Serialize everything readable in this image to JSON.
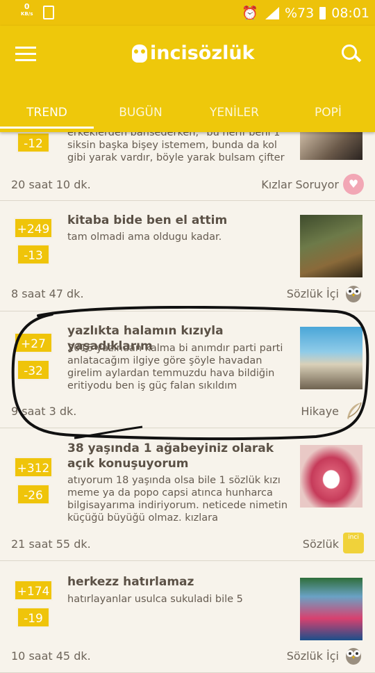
{
  "status_bar": {
    "net_speed": "0",
    "net_unit": "KB/s",
    "battery": "%73",
    "time": "08:01"
  },
  "header": {
    "app_name": "incisözlük"
  },
  "tabs": [
    {
      "label": "TREND"
    },
    {
      "label": "BUGÜN"
    },
    {
      "label": "YENİLER"
    },
    {
      "label": "POPİ"
    }
  ],
  "entries": [
    {
      "up": "",
      "down": "-12",
      "title": "",
      "body": "erkeklerden bahsederken, \"bu herif beni 1 siksin başka bişey istemem, bunda da kol gibi yarak vardır, böyle yarak bulsam çifter",
      "time": "20 saat 10 dk.",
      "source": "Kızlar Soruyor",
      "source_icon": "heart-icon"
    },
    {
      "up": "+249",
      "down": "-13",
      "title": "kitaba bide ben el attim",
      "body": "tam olmadi ama oldugu kadar.",
      "time": "8 saat 47 dk.",
      "source": "Sözlük İçi",
      "source_icon": "owl-icon"
    },
    {
      "up": "+27",
      "down": "-32",
      "title": "yazlıkta halamın kızıyla yaşadıklarım",
      "body": "2016 yazından kalma bi anımdır parti parti anlatacağım ilgiye göre şöyle havadan girelim aylardan temmuzdu hava bildiğin eritiyodu ben iş güç falan sıkıldım",
      "time": "9 saat 3 dk.",
      "source": "Hikaye",
      "source_icon": "feather-icon"
    },
    {
      "up": "+312",
      "down": "-26",
      "title": "38 yaşında 1 ağabeyiniz olarak açık konuşuyorum",
      "body": "atıyorum 18 yaşında olsa bile 1 sözlük kızı meme ya da popo capsi atınca hunharca bilgisayarıma indiriyorum. neticede nimetin küçüğü büyüğü olmaz. kızlara",
      "time": "21 saat 55 dk.",
      "source": "Sözlük",
      "source_icon": "inci-badge-icon",
      "badge_text": "inci"
    },
    {
      "up": "+174",
      "down": "-19",
      "title": "herkezz hatırlamaz",
      "body": "hatırlayanlar usulca sukuladi bile 5",
      "time": "10 saat 45 dk.",
      "source": "Sözlük İçi",
      "source_icon": "owl-icon"
    }
  ],
  "colors": {
    "brand": "#eec80b",
    "background": "#f5f0e6",
    "annotation": "#111111"
  }
}
